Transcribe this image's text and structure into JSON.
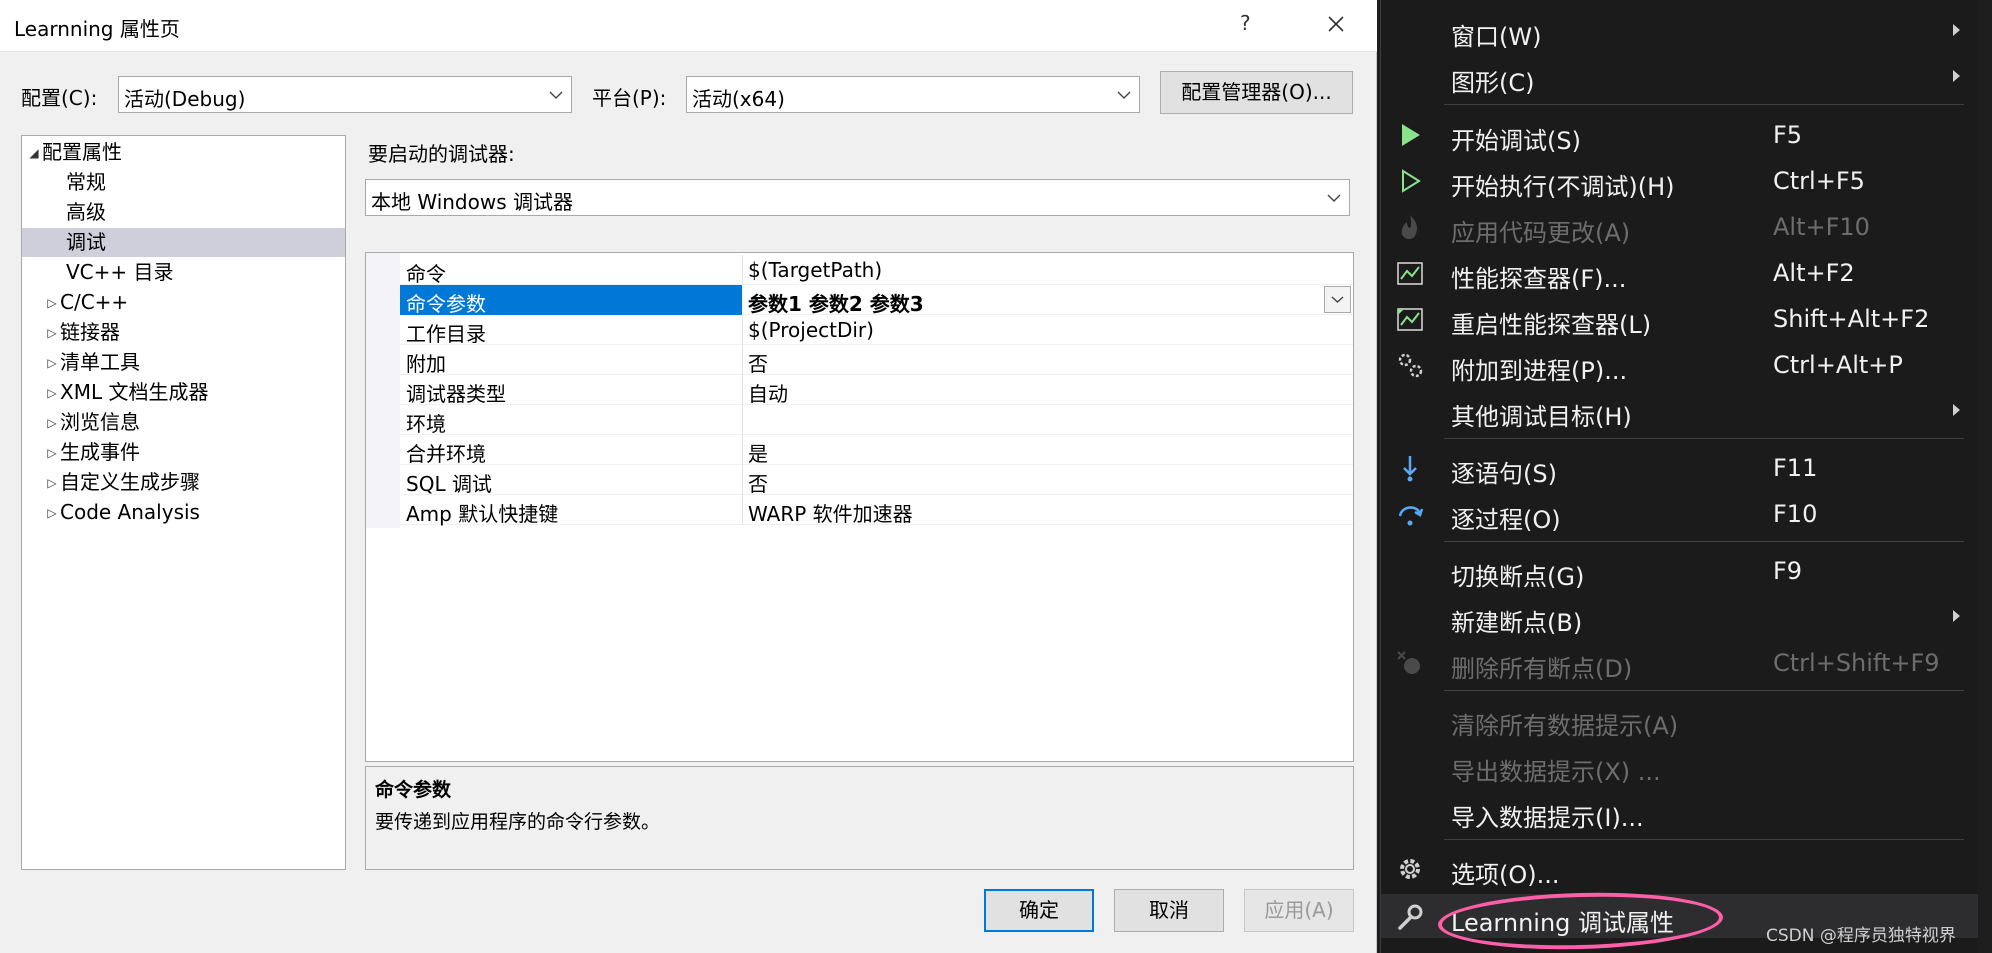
{
  "dialog": {
    "title": "Learnning 属性页",
    "help": "?",
    "config_label": "配置(C):",
    "config_value": "活动(Debug)",
    "platform_label": "平台(P):",
    "platform_value": "活动(x64)",
    "config_manager": "配置管理器(O)...",
    "debugger_label": "要启动的调试器:",
    "debugger_value": "本地 Windows 调试器",
    "tree": [
      {
        "label": "配置属性",
        "expander": "◢"
      },
      {
        "label": "常规"
      },
      {
        "label": "高级"
      },
      {
        "label": "调试",
        "selected": true
      },
      {
        "label": "VC++ 目录"
      },
      {
        "label": "C/C++",
        "expander": "▷"
      },
      {
        "label": "链接器",
        "expander": "▷"
      },
      {
        "label": "清单工具",
        "expander": "▷"
      },
      {
        "label": "XML 文档生成器",
        "expander": "▷"
      },
      {
        "label": "浏览信息",
        "expander": "▷"
      },
      {
        "label": "生成事件",
        "expander": "▷"
      },
      {
        "label": "自定义生成步骤",
        "expander": "▷"
      },
      {
        "label": "Code Analysis",
        "expander": "▷"
      }
    ],
    "properties": [
      {
        "name": "命令",
        "value": "$(TargetPath)"
      },
      {
        "name": "命令参数",
        "value": "参数1 参数2 参数3",
        "selected": true
      },
      {
        "name": "工作目录",
        "value": "$(ProjectDir)"
      },
      {
        "name": "附加",
        "value": "否"
      },
      {
        "name": "调试器类型",
        "value": "自动"
      },
      {
        "name": "环境",
        "value": ""
      },
      {
        "name": "合并环境",
        "value": "是"
      },
      {
        "name": "SQL 调试",
        "value": "否"
      },
      {
        "name": "Amp 默认快捷键",
        "value": "WARP 软件加速器"
      }
    ],
    "description": {
      "title": "命令参数",
      "text": "要传递到应用程序的命令行参数。"
    },
    "buttons": {
      "ok": "确定",
      "cancel": "取消",
      "apply": "应用(A)"
    }
  },
  "menu": {
    "items": [
      {
        "label": "窗口(W)",
        "submenu": true
      },
      {
        "label": "图形(C)",
        "submenu": true
      },
      {
        "label": "开始调试(S)",
        "shortcut": "F5",
        "icon": "play-filled-icon"
      },
      {
        "label": "开始执行(不调试)(H)",
        "shortcut": "Ctrl+F5",
        "icon": "play-outline-icon"
      },
      {
        "label": "应用代码更改(A)",
        "shortcut": "Alt+F10",
        "icon": "flame-icon",
        "disabled": true
      },
      {
        "label": "性能探查器(F)...",
        "shortcut": "Alt+F2",
        "icon": "perf-chart-icon"
      },
      {
        "label": "重启性能探查器(L)",
        "shortcut": "Shift+Alt+F2",
        "icon": "perf-restart-icon"
      },
      {
        "label": "附加到进程(P)...",
        "shortcut": "Ctrl+Alt+P",
        "icon": "gears-icon"
      },
      {
        "label": "其他调试目标(H)",
        "submenu": true
      },
      {
        "label": "逐语句(S)",
        "shortcut": "F11",
        "icon": "step-into-icon"
      },
      {
        "label": "逐过程(O)",
        "shortcut": "F10",
        "icon": "step-over-icon"
      },
      {
        "label": "切换断点(G)",
        "shortcut": "F9"
      },
      {
        "label": "新建断点(B)",
        "submenu": true
      },
      {
        "label": "删除所有断点(D)",
        "shortcut": "Ctrl+Shift+F9",
        "icon": "delete-breakpoints-icon",
        "disabled": true
      },
      {
        "label": "清除所有数据提示(A)",
        "disabled": true
      },
      {
        "label": "导出数据提示(X) ...",
        "disabled": true
      },
      {
        "label": "导入数据提示(I)..."
      },
      {
        "label": "选项(O)...",
        "icon": "gear-icon"
      },
      {
        "label": "Learnning 调试属性",
        "icon": "wrench-icon"
      }
    ],
    "watermark": "CSDN @程序员独特视界"
  },
  "colors": {
    "accent": "#0078d7",
    "menu_bg": "#1b1b1c",
    "play_green": "#8ae28a",
    "highlight_pink": "#ff5fa8"
  }
}
